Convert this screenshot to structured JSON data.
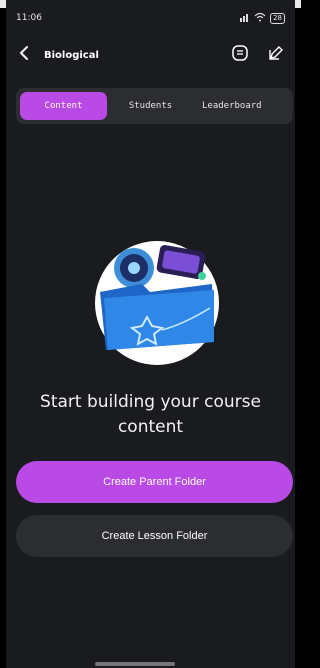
{
  "status_bar": {
    "time": "11:06",
    "battery": "28"
  },
  "header": {
    "title": "Biological"
  },
  "tabs": [
    {
      "label": "Content",
      "active": true
    },
    {
      "label": "Students",
      "active": false
    },
    {
      "label": "Leaderboard",
      "active": false
    }
  ],
  "empty_state": {
    "line1": "Start building your course",
    "line2": "content"
  },
  "actions": {
    "create_parent": "Create Parent Folder",
    "create_lesson": "Create Lesson Folder"
  },
  "colors": {
    "background": "#1a1b1e",
    "accent": "#b94ae6",
    "surface": "#2b2d31"
  },
  "icons": {
    "back": "chevron-left-icon",
    "chat": "chat-icon",
    "edit": "edit-icon",
    "signal": "signal-icon",
    "wifi": "wifi-icon",
    "battery": "battery-icon"
  }
}
